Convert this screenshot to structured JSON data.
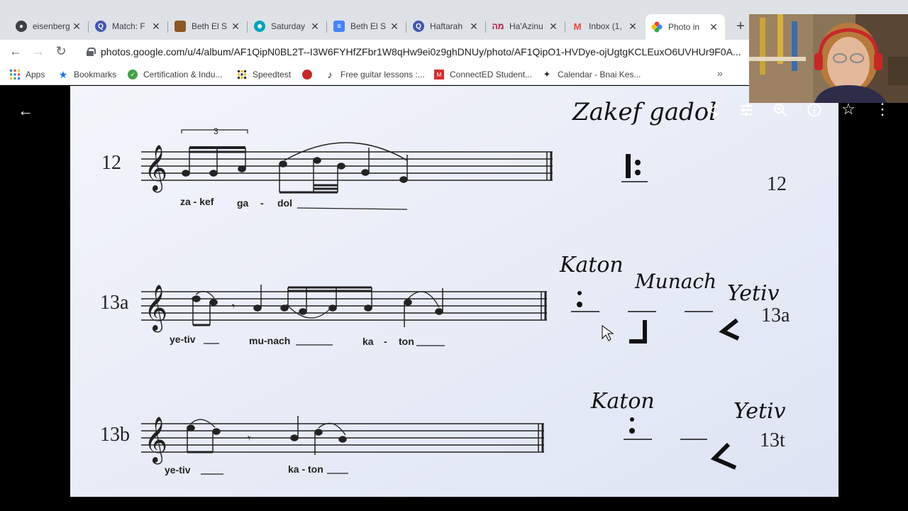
{
  "tabs": [
    {
      "title": "eisenberg",
      "icon": "github-icon",
      "color": "#3c4043"
    },
    {
      "title": "Match: F",
      "icon": "quizlet-icon",
      "color": "#4257b2"
    },
    {
      "title": "Beth El S",
      "icon": "slides-icon",
      "color": "#8d5524"
    },
    {
      "title": "Saturday",
      "icon": "person-icon",
      "color": "#00a4b8"
    },
    {
      "title": "Beth El S",
      "icon": "docs-icon",
      "color": "#4285f4"
    },
    {
      "title": "Haftarah",
      "icon": "quizlet-icon",
      "color": "#4257b2"
    },
    {
      "title": "Ha'Azinu",
      "icon": "hebrew-icon",
      "color": "#b3123f"
    },
    {
      "title": "Inbox (1,",
      "icon": "gmail-icon",
      "color": "#ea4335"
    },
    {
      "title": "Photo in",
      "icon": "photos-icon",
      "color": "#fbbc05",
      "active": true
    }
  ],
  "url": "photos.google.com/u/4/album/AF1QipN0BL2T--I3W6FYHfZFbr1W8qHw9ei0z9ghDNUy/photo/AF1QipO1-HVDye-ojUgtgKCLEuxO6UVHUr9F0A...",
  "bookmarks": [
    {
      "label": "Apps",
      "icon": "apps-grid-icon"
    },
    {
      "label": "Bookmarks",
      "icon": "star-icon"
    },
    {
      "label": "Certification & Indu...",
      "icon": "certification-icon"
    },
    {
      "label": "Speedtest",
      "icon": "speedtest-icon"
    },
    {
      "label": "",
      "icon": "opera-icon"
    },
    {
      "label": "Free guitar lessons :...",
      "icon": "guitar-icon"
    },
    {
      "label": "ConnectED Student...",
      "icon": "connected-icon"
    },
    {
      "label": "Calendar - Bnai Kes...",
      "icon": "calendar-icon"
    }
  ],
  "bookmarks_more": "»",
  "sheet": {
    "rows": [
      {
        "number": "12",
        "lyrics": [
          "za - kef",
          "ga",
          "-",
          "dol"
        ],
        "triplet": "3"
      },
      {
        "number": "13a",
        "lyrics": [
          "ye-tiv",
          "mu-nach",
          "ka",
          "-",
          "ton"
        ]
      },
      {
        "number": "13b",
        "lyrics": [
          "ye-tiv",
          "ka - ton"
        ]
      }
    ],
    "handwritten": {
      "zakef_gadol": "Zakef gadol",
      "katon_a": "Katon",
      "munach": "Munach",
      "yetiv_a": "Yetiv",
      "katon_b": "Katon",
      "yetiv_b": "Yetiv"
    },
    "right_numbers": [
      "12",
      "13a",
      "13t"
    ]
  }
}
